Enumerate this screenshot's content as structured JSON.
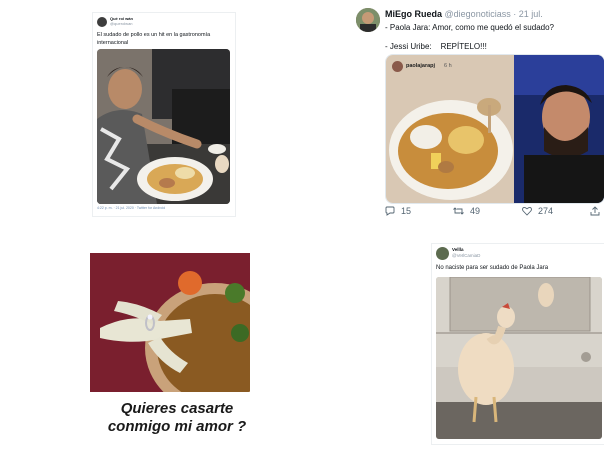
{
  "tweet1": {
    "name": "Qué rol wán",
    "handle": "@querolwan",
    "text": "El sudado de pollo es un hit en la gastronomía internacional",
    "footer": "4:22 p. m. · 21 jul. 2020 · Twitter for Android"
  },
  "tweet2": {
    "name": "MiEgo Rueda",
    "handle": "@diegonoticiass",
    "date": "· 21 jul.",
    "line1": "- Paola Jara: Amor, como me quedó el sudado?",
    "line2": "- Jessi Uribe:    REPÍTELO!!!",
    "embed_user": "paolajarapj",
    "embed_time": "6 h",
    "replies": "15",
    "retweets": "49",
    "likes": "274"
  },
  "meme": {
    "caption_line1": "Quieres casarte",
    "caption_line2": "conmigo mi amor ?"
  },
  "tweet3": {
    "name": "Vellla",
    "handle": "@VeIlCamiaD",
    "text": "No naciste para ser sudado de Paola Jara"
  }
}
